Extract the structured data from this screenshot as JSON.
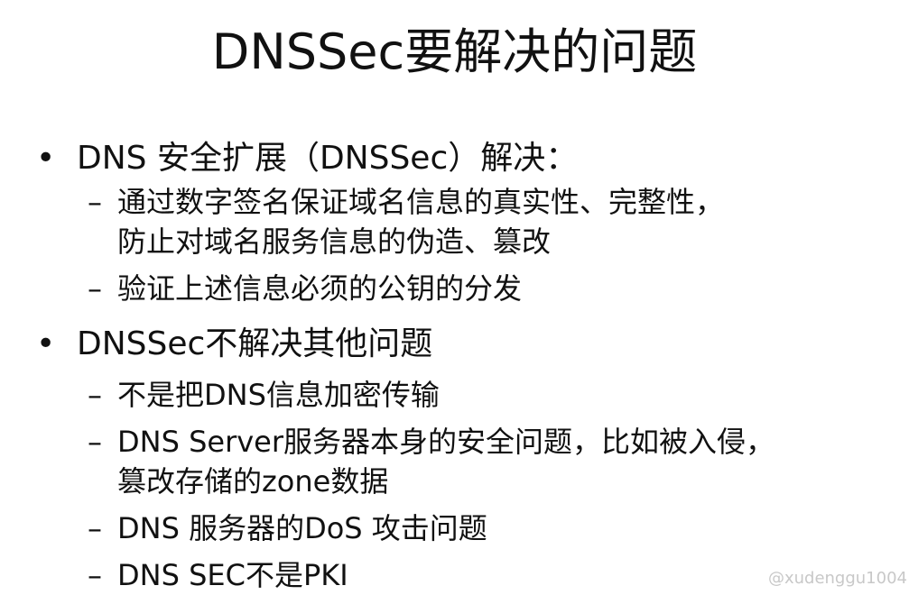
{
  "title": "DNSSec要解决的问题",
  "bullets": [
    {
      "text": "DNS 安全扩展（DNSSec）解决：",
      "items": [
        {
          "line1": "通过数字签名保证域名信息的真实性、完整性，",
          "line2": "防止对域名服务信息的伪造、篡改"
        },
        {
          "line1": "验证上述信息必须的公钥的分发"
        }
      ]
    },
    {
      "text": "DNSSec不解决其他问题",
      "items": [
        {
          "line1": "不是把DNS信息加密传输"
        },
        {
          "line1": "DNS Server服务器本身的安全问题，比如被入侵，",
          "line2": "篡改存储的zone数据"
        },
        {
          "line1": "DNS 服务器的DoS 攻击问题"
        },
        {
          "line1": "DNS SEC不是PKI"
        }
      ]
    }
  ],
  "bullet_symbol": "•",
  "dash_symbol": "–",
  "watermark": "@xudenggu1004"
}
